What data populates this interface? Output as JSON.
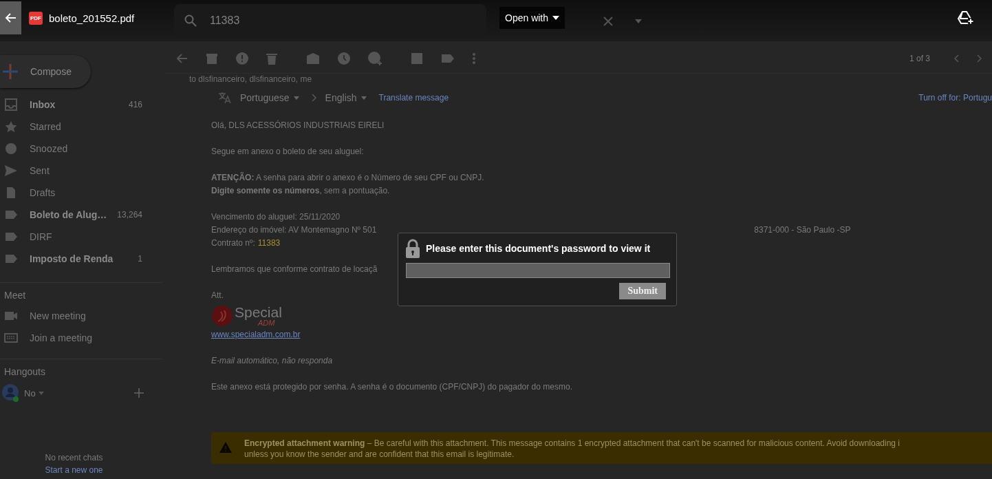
{
  "viewer": {
    "file_badge": "PDF",
    "file_name": "boleto_201552.pdf",
    "open_with": "Open with"
  },
  "search": {
    "value": "11383"
  },
  "toolbar": {
    "pager": "1 of 3"
  },
  "sidebar": {
    "compose": "Compose",
    "items": [
      {
        "label": "Inbox",
        "count": "416",
        "unread": true
      },
      {
        "label": "Starred",
        "unread": false
      },
      {
        "label": "Snoozed",
        "unread": false
      },
      {
        "label": "Sent",
        "unread": false
      },
      {
        "label": "Drafts",
        "unread": false
      },
      {
        "label": "Boleto de Alug…",
        "count": "13,264",
        "unread": true
      },
      {
        "label": "DIRF",
        "unread": false
      },
      {
        "label": "Imposto de Renda",
        "count": "1",
        "unread": true
      }
    ],
    "meet": {
      "title": "Meet",
      "items": [
        "New meeting",
        "Join a meeting"
      ]
    },
    "hangouts": {
      "title": "Hangouts",
      "user": "No",
      "empty": "No recent chats",
      "start": "Start a new one"
    }
  },
  "email": {
    "recipients": "to dlsfinanceiro, dlsfinanceiro, me",
    "translate": {
      "from": "Portuguese",
      "to": "English",
      "action": "Translate message",
      "turn_off": "Turn off for: Portugu"
    },
    "greeting": "Olá, DLS ACESSÓRIOS INDUSTRIAIS EIRELI",
    "intro": "Segue em anexo o boleto de seu aluguel:",
    "notice": [
      "**ATENÇÃO:** A senha para abrir o anexo é o Número de seu CPF ou CNPJ.",
      "**Digite somente os números**, sem a pontuação."
    ],
    "due": "Vencimento do aluguel: 25/11/2020",
    "address_left": "Endereço do imóvel: AV Montemagno Nº 501",
    "address_right": "8371-000 - São Paulo -SP",
    "contract_label": "Contrato nº:",
    "contract_value": "11383",
    "reminder": "Lembramos que conforme contrato de locaçã",
    "signoff": "Att.",
    "logo": {
      "name": "Special",
      "sub": "ADM"
    },
    "website": "www.specialadm.com.br",
    "auto": "E-mail automático, não responda",
    "protected": "Este anexo está protegido por senha. A senha é o documento (CPF/CNPJ) do pagador do mesmo.",
    "warning": {
      "lines": [
        "**Encrypted attachment warning** – Be careful with this attachment. This message contains 1 encrypted attachment that can't be scanned for malicious content. Avoid downloading i",
        "unless you know the sender and are confident that this email is legitimate."
      ]
    }
  },
  "password_dialog": {
    "title": "Please enter this document's password to view it",
    "submit": "Submit",
    "submit_disabled": true
  }
}
